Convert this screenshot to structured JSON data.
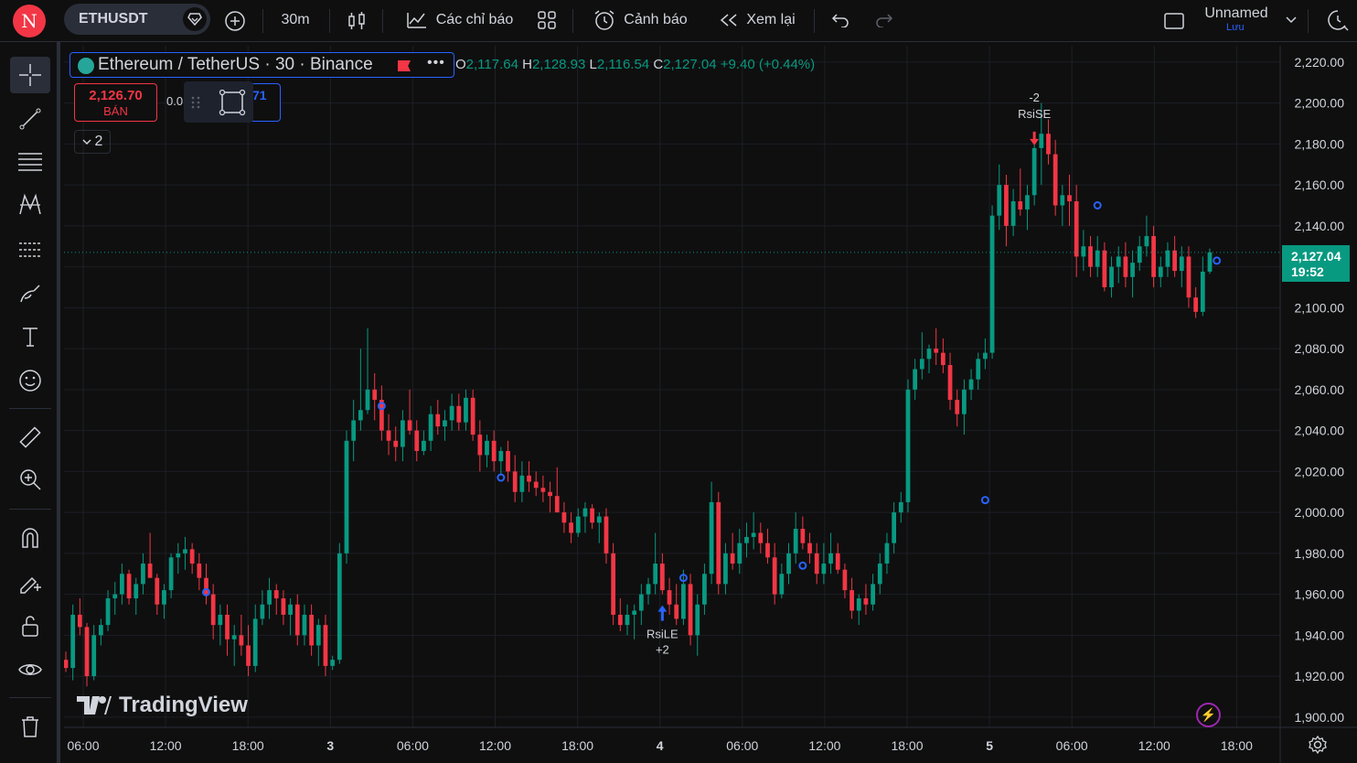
{
  "topbar": {
    "avatar_letter": "N",
    "symbol": "ETHUSDT",
    "interval": "30m",
    "indicators_label": "Các chỉ báo",
    "alert_label": "Cảnh báo",
    "replay_label": "Xem lại",
    "layout_name": "Unnamed",
    "save_label": "Lưu"
  },
  "legend": {
    "title": "Ethereum / TetherUS · 30 · Binance",
    "more": "•••",
    "o_label": "O",
    "o": "2,117.64",
    "h_label": "H",
    "h": "2,128.93",
    "l_label": "L",
    "l": "2,116.54",
    "c_label": "C",
    "c": "2,127.04",
    "change": "+9.40 (+0.44%)"
  },
  "trade": {
    "sell_price": "2,126.70",
    "sell_label": "BÁN",
    "spread": "0.0",
    "buy_price_fragment": "71",
    "collapse_count": "2"
  },
  "branding": {
    "logo_text": "TradingView"
  },
  "current_price": {
    "price": "2,127.04",
    "countdown": "19:52"
  },
  "colors": {
    "up": "#089981",
    "down": "#f23645",
    "accent": "#2962ff",
    "background": "#0f0f0f"
  },
  "chart_data": {
    "type": "candlestick",
    "symbol": "ETHUSDT",
    "interval": "30",
    "price_axis": {
      "ticks": [
        "2,220.00",
        "2,200.00",
        "2,180.00",
        "2,160.00",
        "2,140.00",
        "2,120.00",
        "2,100.00",
        "2,080.00",
        "2,060.00",
        "2,040.00",
        "2,020.00",
        "2,000.00",
        "1,980.00",
        "1,960.00",
        "1,940.00",
        "1,920.00",
        "1,900.00"
      ],
      "ylim": [
        1895,
        2228
      ]
    },
    "time_axis": {
      "ticks": [
        "06:00",
        "12:00",
        "18:00",
        "3",
        "06:00",
        "12:00",
        "18:00",
        "4",
        "06:00",
        "12:00",
        "18:00",
        "5",
        "06:00",
        "12:00",
        "18:00"
      ],
      "bold": [
        false,
        false,
        false,
        true,
        false,
        false,
        false,
        true,
        false,
        false,
        false,
        true,
        false,
        false,
        false
      ]
    },
    "candles": [
      [
        1928,
        1932,
        1922,
        1924
      ],
      [
        1924,
        1955,
        1918,
        1950
      ],
      [
        1950,
        1958,
        1940,
        1944
      ],
      [
        1944,
        1946,
        1915,
        1920
      ],
      [
        1920,
        1945,
        1918,
        1940
      ],
      [
        1940,
        1948,
        1935,
        1945
      ],
      [
        1945,
        1962,
        1942,
        1958
      ],
      [
        1958,
        1966,
        1950,
        1960
      ],
      [
        1960,
        1975,
        1955,
        1970
      ],
      [
        1970,
        1972,
        1955,
        1958
      ],
      [
        1958,
        1968,
        1950,
        1965
      ],
      [
        1965,
        1980,
        1960,
        1975
      ],
      [
        1975,
        1990,
        1968,
        1968
      ],
      [
        1968,
        1970,
        1950,
        1955
      ],
      [
        1955,
        1965,
        1948,
        1962
      ],
      [
        1962,
        1980,
        1958,
        1978
      ],
      [
        1978,
        1985,
        1970,
        1980
      ],
      [
        1980,
        1988,
        1972,
        1982
      ],
      [
        1982,
        1985,
        1970,
        1975
      ],
      [
        1975,
        1980,
        1962,
        1968
      ],
      [
        1968,
        1975,
        1955,
        1960
      ],
      [
        1960,
        1965,
        1938,
        1945
      ],
      [
        1945,
        1955,
        1935,
        1950
      ],
      [
        1950,
        1955,
        1930,
        1938
      ],
      [
        1938,
        1945,
        1925,
        1940
      ],
      [
        1940,
        1950,
        1930,
        1935
      ],
      [
        1935,
        1945,
        1920,
        1925
      ],
      [
        1925,
        1955,
        1922,
        1948
      ],
      [
        1948,
        1962,
        1945,
        1955
      ],
      [
        1955,
        1968,
        1948,
        1962
      ],
      [
        1962,
        1965,
        1950,
        1958
      ],
      [
        1958,
        1962,
        1945,
        1950
      ],
      [
        1950,
        1958,
        1940,
        1955
      ],
      [
        1955,
        1960,
        1935,
        1940
      ],
      [
        1940,
        1955,
        1935,
        1950
      ],
      [
        1950,
        1955,
        1930,
        1935
      ],
      [
        1935,
        1948,
        1925,
        1945
      ],
      [
        1945,
        1950,
        1920,
        1925
      ],
      [
        1925,
        1930,
        1923,
        1928
      ],
      [
        1928,
        1985,
        1926,
        1980
      ],
      [
        1980,
        2040,
        1975,
        2035
      ],
      [
        2035,
        2055,
        2025,
        2045
      ],
      [
        2045,
        2080,
        2040,
        2050
      ],
      [
        2050,
        2090,
        2048,
        2060
      ],
      [
        2060,
        2068,
        2045,
        2055
      ],
      [
        2055,
        2062,
        2035,
        2040
      ],
      [
        2040,
        2048,
        2028,
        2035
      ],
      [
        2035,
        2042,
        2025,
        2032
      ],
      [
        2032,
        2050,
        2025,
        2045
      ],
      [
        2045,
        2060,
        2038,
        2040
      ],
      [
        2040,
        2045,
        2025,
        2030
      ],
      [
        2030,
        2040,
        2028,
        2035
      ],
      [
        2035,
        2052,
        2030,
        2048
      ],
      [
        2048,
        2055,
        2038,
        2042
      ],
      [
        2042,
        2050,
        2035,
        2045
      ],
      [
        2045,
        2058,
        2040,
        2052
      ],
      [
        2052,
        2058,
        2040,
        2044
      ],
      [
        2044,
        2060,
        2040,
        2056
      ],
      [
        2056,
        2060,
        2035,
        2038
      ],
      [
        2038,
        2045,
        2020,
        2028
      ],
      [
        2028,
        2038,
        2022,
        2035
      ],
      [
        2035,
        2040,
        2020,
        2025
      ],
      [
        2025,
        2032,
        2018,
        2030
      ],
      [
        2030,
        2035,
        2015,
        2020
      ],
      [
        2020,
        2028,
        2005,
        2010
      ],
      [
        2010,
        2025,
        2005,
        2018
      ],
      [
        2018,
        2025,
        2010,
        2015
      ],
      [
        2015,
        2020,
        2008,
        2012
      ],
      [
        2012,
        2018,
        2005,
        2010
      ],
      [
        2010,
        2015,
        2000,
        2008
      ],
      [
        2008,
        2022,
        2005,
        2000
      ],
      [
        2000,
        2005,
        1990,
        1995
      ],
      [
        1995,
        2000,
        1985,
        1990
      ],
      [
        1990,
        2002,
        1988,
        1998
      ],
      [
        1998,
        2005,
        1990,
        2002
      ],
      [
        2002,
        2004,
        1992,
        1995
      ],
      [
        1995,
        2000,
        1985,
        1998
      ],
      [
        1998,
        2002,
        1975,
        1980
      ],
      [
        1980,
        1985,
        1945,
        1950
      ],
      [
        1950,
        1958,
        1942,
        1945
      ],
      [
        1945,
        1955,
        1940,
        1950
      ],
      [
        1950,
        1955,
        1938,
        1952
      ],
      [
        1952,
        1965,
        1945,
        1960
      ],
      [
        1960,
        1968,
        1955,
        1965
      ],
      [
        1965,
        1990,
        1960,
        1975
      ],
      [
        1975,
        1980,
        1960,
        1962
      ],
      [
        1962,
        1968,
        1950,
        1955
      ],
      [
        1955,
        1965,
        1945,
        1948
      ],
      [
        1948,
        1972,
        1945,
        1965
      ],
      [
        1965,
        1970,
        1935,
        1940
      ],
      [
        1940,
        1960,
        1930,
        1955
      ],
      [
        1955,
        1975,
        1950,
        1970
      ],
      [
        1970,
        2015,
        1965,
        2005
      ],
      [
        2005,
        2010,
        1960,
        1965
      ],
      [
        1965,
        1985,
        1960,
        1980
      ],
      [
        1980,
        1990,
        1972,
        1975
      ],
      [
        1975,
        1992,
        1970,
        1985
      ],
      [
        1985,
        1995,
        1978,
        1988
      ],
      [
        1988,
        2000,
        1982,
        1990
      ],
      [
        1990,
        1995,
        1980,
        1985
      ],
      [
        1985,
        1992,
        1975,
        1978
      ],
      [
        1978,
        1985,
        1955,
        1960
      ],
      [
        1960,
        1975,
        1958,
        1970
      ],
      [
        1970,
        1985,
        1965,
        1980
      ],
      [
        1980,
        2000,
        1975,
        1992
      ],
      [
        1992,
        1998,
        1982,
        1985
      ],
      [
        1985,
        1990,
        1975,
        1980
      ],
      [
        1980,
        1985,
        1965,
        1970
      ],
      [
        1970,
        1985,
        1965,
        1975
      ],
      [
        1975,
        1990,
        1970,
        1980
      ],
      [
        1980,
        1985,
        1970,
        1972
      ],
      [
        1972,
        1975,
        1958,
        1962
      ],
      [
        1962,
        1968,
        1948,
        1952
      ],
      [
        1952,
        1960,
        1945,
        1958
      ],
      [
        1958,
        1965,
        1950,
        1955
      ],
      [
        1955,
        1970,
        1952,
        1965
      ],
      [
        1965,
        1980,
        1960,
        1975
      ],
      [
        1975,
        1990,
        1970,
        1985
      ],
      [
        1985,
        2005,
        1980,
        2000
      ],
      [
        2000,
        2010,
        1995,
        2005
      ],
      [
        2005,
        2065,
        2000,
        2060
      ],
      [
        2060,
        2075,
        2055,
        2070
      ],
      [
        2070,
        2088,
        2065,
        2075
      ],
      [
        2075,
        2082,
        2068,
        2080
      ],
      [
        2080,
        2090,
        2072,
        2078
      ],
      [
        2078,
        2085,
        2068,
        2072
      ],
      [
        2072,
        2078,
        2050,
        2055
      ],
      [
        2055,
        2060,
        2042,
        2048
      ],
      [
        2048,
        2065,
        2038,
        2060
      ],
      [
        2060,
        2070,
        2055,
        2065
      ],
      [
        2065,
        2078,
        2060,
        2075
      ],
      [
        2075,
        2085,
        2070,
        2078
      ],
      [
        2078,
        2150,
        2075,
        2145
      ],
      [
        2145,
        2170,
        2138,
        2160
      ],
      [
        2160,
        2165,
        2130,
        2140
      ],
      [
        2140,
        2158,
        2135,
        2152
      ],
      [
        2152,
        2168,
        2145,
        2148
      ],
      [
        2148,
        2160,
        2138,
        2155
      ],
      [
        2155,
        2182,
        2150,
        2178
      ],
      [
        2178,
        2200,
        2160,
        2185
      ],
      [
        2185,
        2192,
        2170,
        2175
      ],
      [
        2175,
        2182,
        2145,
        2150
      ],
      [
        2150,
        2160,
        2140,
        2155
      ],
      [
        2155,
        2165,
        2140,
        2152
      ],
      [
        2152,
        2160,
        2115,
        2125
      ],
      [
        2125,
        2138,
        2118,
        2130
      ],
      [
        2130,
        2135,
        2115,
        2120
      ],
      [
        2120,
        2135,
        2115,
        2128
      ],
      [
        2128,
        2132,
        2108,
        2110
      ],
      [
        2110,
        2125,
        2105,
        2120
      ],
      [
        2120,
        2130,
        2112,
        2125
      ],
      [
        2125,
        2132,
        2110,
        2115
      ],
      [
        2115,
        2128,
        2105,
        2122
      ],
      [
        2122,
        2135,
        2118,
        2130
      ],
      [
        2130,
        2145,
        2125,
        2135
      ],
      [
        2135,
        2140,
        2110,
        2115
      ],
      [
        2115,
        2125,
        2110,
        2120
      ],
      [
        2120,
        2132,
        2115,
        2128
      ],
      [
        2128,
        2135,
        2115,
        2118
      ],
      [
        2118,
        2130,
        2110,
        2125
      ],
      [
        2125,
        2130,
        2100,
        2105
      ],
      [
        2105,
        2110,
        2095,
        2098
      ],
      [
        2098,
        2125,
        2096,
        2117.64
      ],
      [
        2117.64,
        2128.93,
        2116.54,
        2127.04
      ]
    ],
    "markers": [
      {
        "candle": 20,
        "shape": "circle",
        "price": 1961
      },
      {
        "candle": 45,
        "shape": "circle",
        "price": 2052
      },
      {
        "candle": 62,
        "shape": "circle",
        "price": 2017
      },
      {
        "candle": 88,
        "shape": "circle",
        "price": 1968
      },
      {
        "candle": 105,
        "shape": "circle",
        "price": 1974
      },
      {
        "candle": 131,
        "shape": "circle",
        "price": 2006
      },
      {
        "candle": 147,
        "shape": "circle",
        "price": 2150
      },
      {
        "candle": 164,
        "shape": "circle",
        "price": 2123
      }
    ],
    "signals": [
      {
        "candle": 85,
        "direction": "long",
        "label": "RsiLE",
        "qty": "+2"
      },
      {
        "candle": 138,
        "direction": "short",
        "label": "RsiSE",
        "qty": "-2"
      }
    ],
    "current_price": 2127.04
  }
}
